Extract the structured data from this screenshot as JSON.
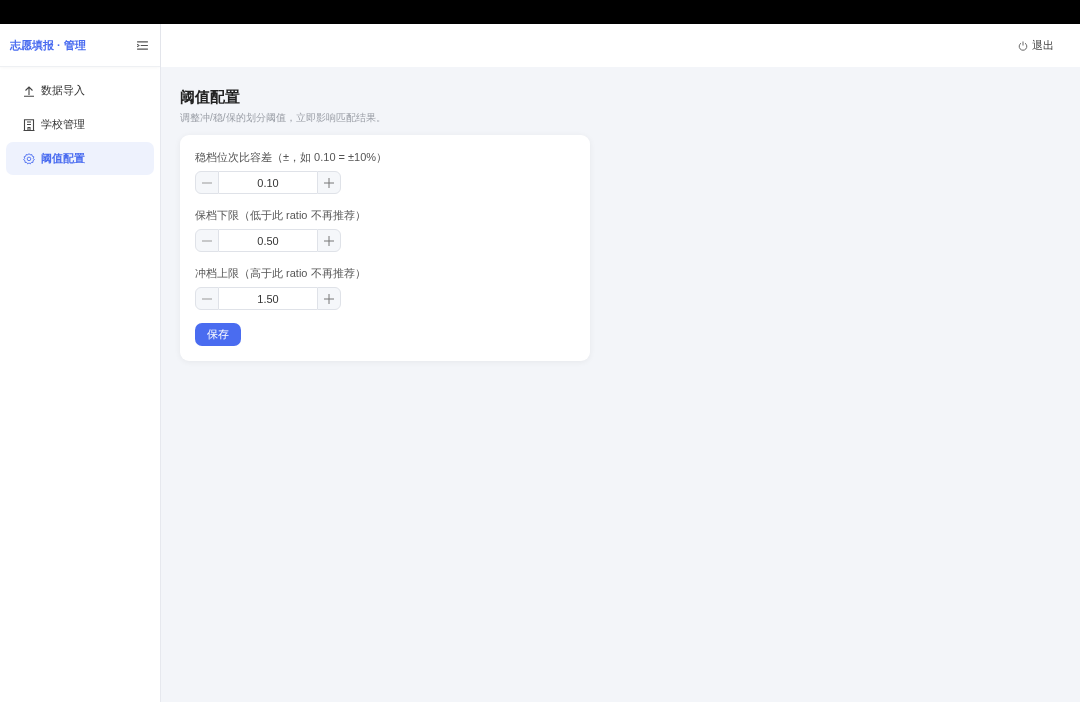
{
  "sidebar": {
    "title": "志愿填报 · 管理",
    "items": [
      {
        "label": "数据导入",
        "selected": false
      },
      {
        "label": "学校管理",
        "selected": false
      },
      {
        "label": "阈值配置",
        "selected": true
      }
    ]
  },
  "header": {
    "logout": "退出"
  },
  "page": {
    "title": "阈值配置",
    "subtitle": "调整冲/稳/保的划分阈值，立即影响匹配结果。"
  },
  "form": {
    "fields": [
      {
        "label": "稳档位次比容差（±，如 0.10 = ±10%）",
        "value": "0.10"
      },
      {
        "label": "保档下限（低于此 ratio 不再推荐）",
        "value": "0.50"
      },
      {
        "label": "冲档上限（高于此 ratio 不再推荐）",
        "value": "1.50"
      }
    ],
    "save_button": "保存"
  }
}
